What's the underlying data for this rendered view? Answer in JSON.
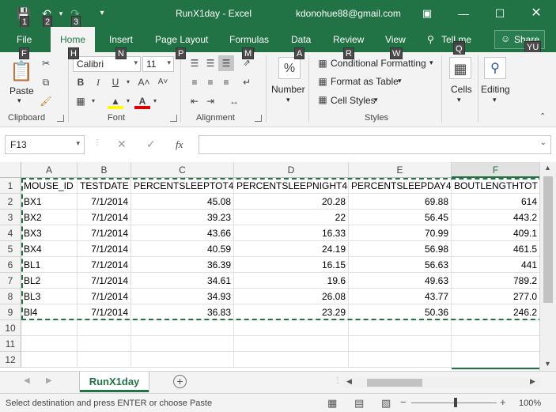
{
  "window": {
    "title": "RunX1day - Excel",
    "user": "kdonohue88@gmail.com",
    "keytips_qat": [
      "1",
      "2",
      "3"
    ]
  },
  "ribbon_tabs": [
    {
      "label": "File",
      "keytip": "F"
    },
    {
      "label": "Home",
      "keytip": "H",
      "active": true
    },
    {
      "label": "Insert",
      "keytip": "N"
    },
    {
      "label": "Page Layout",
      "keytip": "P"
    },
    {
      "label": "Formulas",
      "keytip": "M"
    },
    {
      "label": "Data",
      "keytip": "A"
    },
    {
      "label": "Review",
      "keytip": "R"
    },
    {
      "label": "View",
      "keytip": "W"
    },
    {
      "label": "Tell me",
      "keytip": "Q"
    }
  ],
  "share": {
    "label": "Share",
    "keytip": "YU"
  },
  "ribbon": {
    "clipboard": {
      "label": "Clipboard",
      "paste": "Paste"
    },
    "font": {
      "label": "Font",
      "name": "Calibri",
      "size": "11"
    },
    "alignment": {
      "label": "Alignment"
    },
    "number": {
      "label": "Number",
      "format_symbol": "%"
    },
    "styles": {
      "label": "Styles",
      "conditional": "Conditional Formatting",
      "format_table": "Format as Table",
      "cell_styles": "Cell Styles"
    },
    "cells": {
      "label": "Cells"
    },
    "editing": {
      "label": "Editing"
    }
  },
  "formula_bar": {
    "name_box": "F13",
    "fx": "fx",
    "value": ""
  },
  "columns": [
    "A",
    "B",
    "C",
    "D",
    "E",
    "F"
  ],
  "rows": [
    [
      "MOUSE_ID",
      "TESTDATE",
      "PERCENTSLEEPTOT4",
      "PERCENTSLEEPNIGHT4",
      "PERCENTSLEEPDAY4",
      "BOUTLENGTHTOT"
    ],
    [
      "BX1",
      "7/1/2014",
      "45.08",
      "20.28",
      "69.88",
      "614"
    ],
    [
      "BX2",
      "7/1/2014",
      "39.23",
      "22",
      "56.45",
      "443.2"
    ],
    [
      "BX3",
      "7/1/2014",
      "43.66",
      "16.33",
      "70.99",
      "409.1"
    ],
    [
      "BX4",
      "7/1/2014",
      "40.59",
      "24.19",
      "56.98",
      "461.5"
    ],
    [
      "BL1",
      "7/1/2014",
      "36.39",
      "16.15",
      "56.63",
      "441"
    ],
    [
      "BL2",
      "7/1/2014",
      "34.61",
      "19.6",
      "49.63",
      "789.2"
    ],
    [
      "BL3",
      "7/1/2014",
      "34.93",
      "26.08",
      "43.77",
      "277.0"
    ],
    [
      "Bl4",
      "7/1/2014",
      "36.83",
      "23.29",
      "50.36",
      "246.2"
    ],
    [
      "",
      "",
      "",
      "",
      "",
      ""
    ],
    [
      "",
      "",
      "",
      "",
      "",
      ""
    ],
    [
      "",
      "",
      "",
      "",
      "",
      ""
    ]
  ],
  "row_numbers": [
    "1",
    "2",
    "3",
    "4",
    "5",
    "6",
    "7",
    "8",
    "9",
    "10",
    "11",
    "12"
  ],
  "sheet": {
    "name": "RunX1day"
  },
  "status": {
    "text": "Select destination and press ENTER or choose Paste",
    "zoom": "100%"
  }
}
